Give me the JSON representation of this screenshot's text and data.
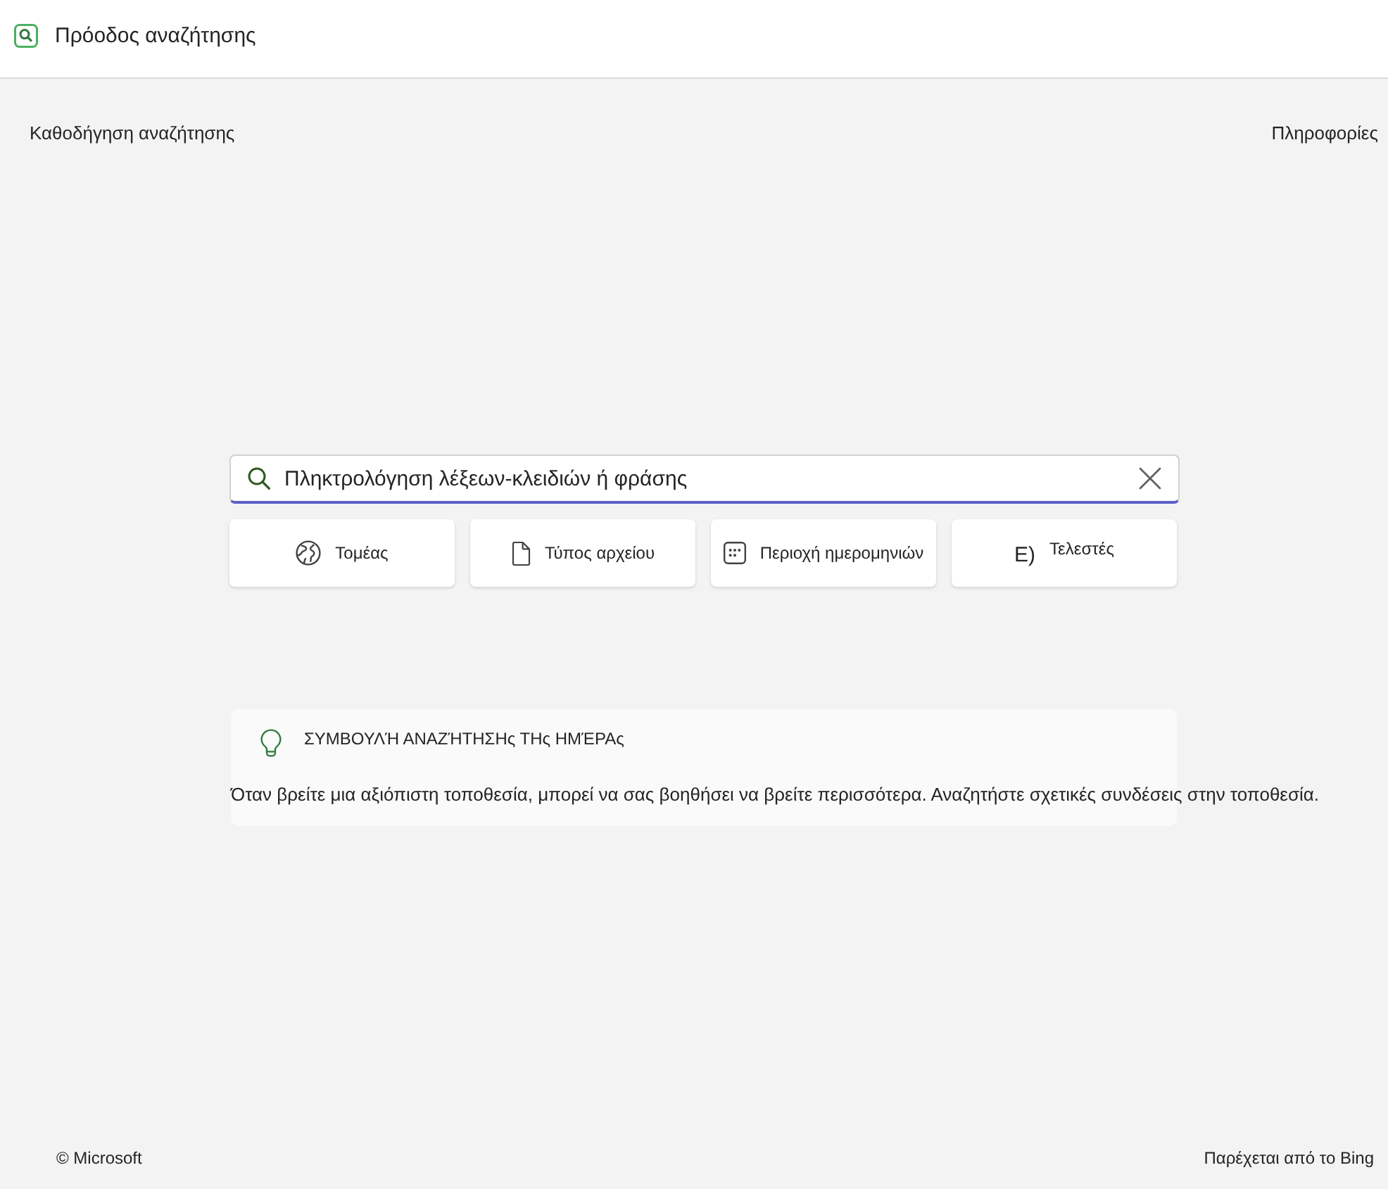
{
  "header": {
    "title": "Πρόοδος αναζήτησης"
  },
  "nav": {
    "left": "Καθοδήγηση αναζήτησης",
    "right": "Πληροφορίες"
  },
  "search": {
    "placeholder": "Πληκτρολόγηση λέξεων-κλειδιών ή φράσης"
  },
  "filters": [
    {
      "kind": "domain",
      "label": "Τομέας"
    },
    {
      "kind": "filetype",
      "label": "Τύπος αρχείου"
    },
    {
      "kind": "daterange",
      "label": "Περιοχή ημερομηνιών"
    },
    {
      "kind": "operators",
      "glyph": "E)",
      "label": "Τελεστές"
    }
  ],
  "tip": {
    "heading": "ΣΥΜΒΟΥΛΉ ΑΝΑΖΉΤΗΣΗς ΤΗς ΗΜΈΡΑς",
    "text": "Όταν βρείτε μια αξιόπιστη τοποθεσία, μπορεί να σας βοηθήσει να βρείτε περισσότερα. Αναζητήστε σχετικές συνδέσεις στην τοποθεσία."
  },
  "footer": {
    "left": "© Microsoft",
    "right": "Παρέχεται από το Bing"
  }
}
